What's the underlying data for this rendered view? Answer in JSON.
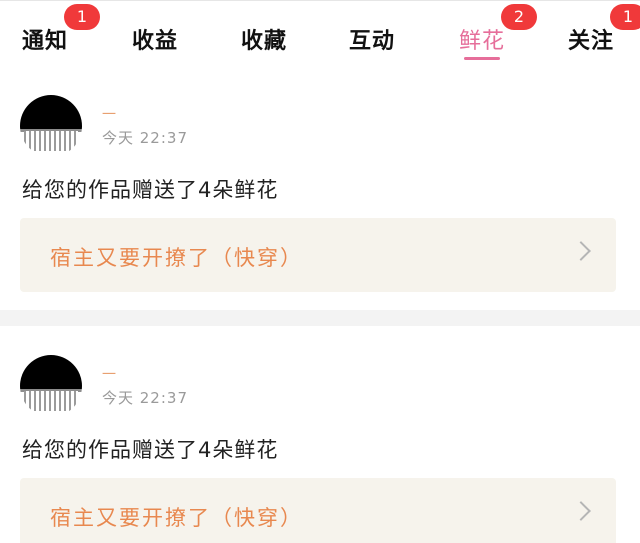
{
  "tabs": [
    {
      "label": "通知",
      "badge": "1",
      "active": false
    },
    {
      "label": "收益",
      "badge": "",
      "active": false
    },
    {
      "label": "收藏",
      "badge": "",
      "active": false
    },
    {
      "label": "互动",
      "badge": "",
      "active": false
    },
    {
      "label": "鲜花",
      "badge": "2",
      "active": true
    },
    {
      "label": "关注",
      "badge": "1",
      "active": false
    }
  ],
  "notifications": [
    {
      "username": "一",
      "time": "今天  22:37",
      "message": "给您的作品赠送了4朵鲜花",
      "work_title": "宿主又要开撩了（快穿）"
    },
    {
      "username": "一",
      "time": "今天  22:37",
      "message": "给您的作品赠送了4朵鲜花",
      "work_title": "宿主又要开撩了（快穿）"
    }
  ],
  "colors": {
    "accent": "#e66e9a",
    "badge": "#f0393a",
    "work_title": "#e8884f",
    "work_box_bg": "#f6f3ec"
  }
}
